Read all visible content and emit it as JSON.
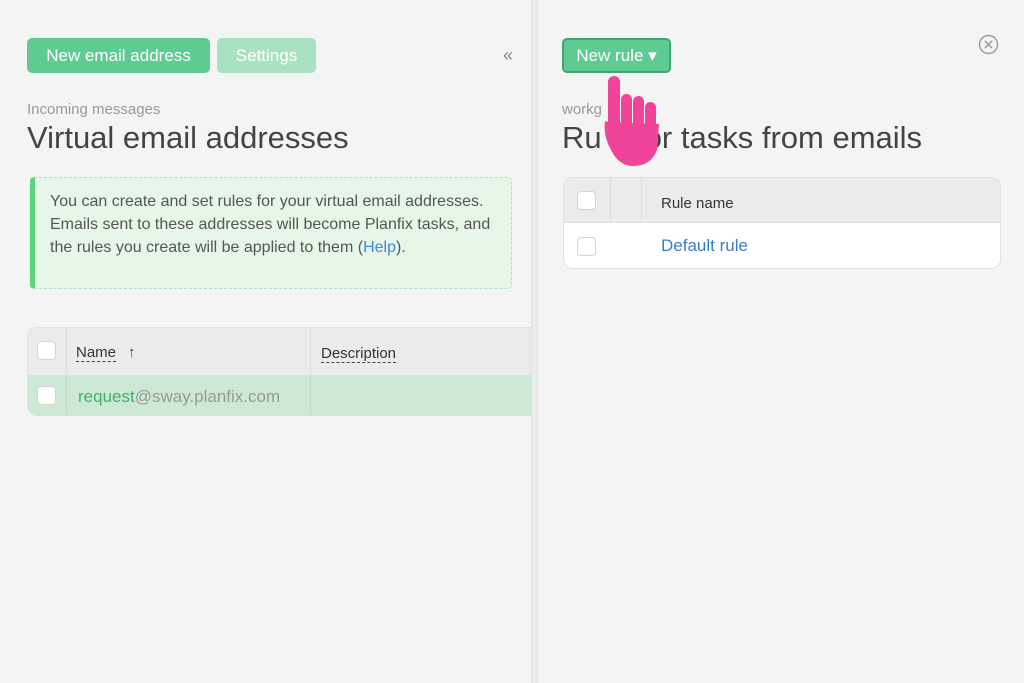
{
  "left": {
    "new_email_button": "New email address",
    "settings_button": "Settings",
    "collapse_icon": "double-chevron-left-icon",
    "subtitle": "Incoming messages",
    "title": "Virtual email addresses",
    "info": {
      "text_before": "You can create and set rules for your virtual email addresses. Emails sent to these addresses will become Planfix tasks, and the rules you create will be applied to them (",
      "help_link": "Help",
      "text_after": ")."
    },
    "table": {
      "columns": [
        "Name",
        "Description"
      ],
      "sort_icon": "↑",
      "rows": [
        {
          "email_user": "request",
          "email_domain": "@sway.planfix.com",
          "description": ""
        }
      ]
    }
  },
  "right": {
    "new_rule_button": "New rule ▾",
    "close_icon": "close-circle-icon",
    "subtitle": "workg",
    "title": "Ru     or tasks from emails",
    "table": {
      "columns": [
        "Rule name"
      ],
      "rows": [
        {
          "name": "Default rule"
        }
      ]
    }
  },
  "colors": {
    "accent_green": "#5ecb92",
    "link_blue": "#3a7dbf",
    "hand_pointer": "#f0449a"
  }
}
